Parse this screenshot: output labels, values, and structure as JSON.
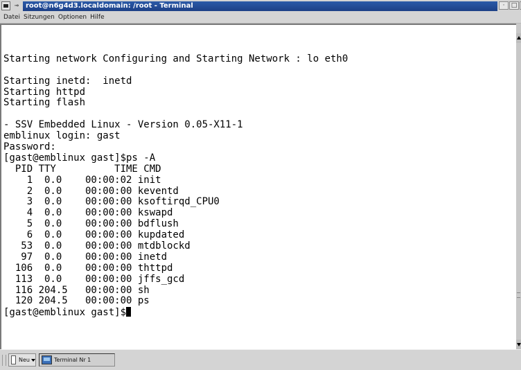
{
  "window": {
    "title": "root@n6g4d3.localdomain: /root - Terminal",
    "controls": {
      "minimize": "·",
      "maximize": "□",
      "close": "X"
    }
  },
  "menu": [
    "Datei",
    "Sitzungen",
    "Optionen",
    "Hilfe"
  ],
  "terminal": {
    "lines": [
      "",
      "Starting network Configuring and Starting Network : lo eth0",
      "",
      "Starting inetd:  inetd",
      "Starting httpd",
      "Starting flash",
      "",
      "- SSV Embedded Linux - Version 0.05-X11-1",
      "emblinux login: gast",
      "Password:",
      "[gast@emblinux gast]$ps -A",
      "  PID TTY          TIME CMD",
      "    1  0.0    00:00:02 init",
      "    2  0.0    00:00:00 keventd",
      "    3  0.0    00:00:00 ksoftirqd_CPU0",
      "    4  0.0    00:00:00 kswapd",
      "    5  0.0    00:00:00 bdflush",
      "    6  0.0    00:00:00 kupdated",
      "   53  0.0    00:00:00 mtdblockd",
      "   97  0.0    00:00:00 inetd",
      "  106  0.0    00:00:00 thttpd",
      "  113  0.0    00:00:00 jffs_gcd",
      "  116 204.5   00:00:00 sh",
      "  120 204.5   00:00:00 ps"
    ],
    "prompt": "[gast@emblinux gast]$"
  },
  "taskbar": {
    "new_label": "Neu",
    "tabs": [
      {
        "label": "Terminal Nr 1"
      }
    ]
  },
  "colors": {
    "titlebar": "#2b5aa8",
    "terminal_bg": "#ffffff",
    "terminal_fg": "#000000",
    "chrome": "#d4d4d4"
  }
}
